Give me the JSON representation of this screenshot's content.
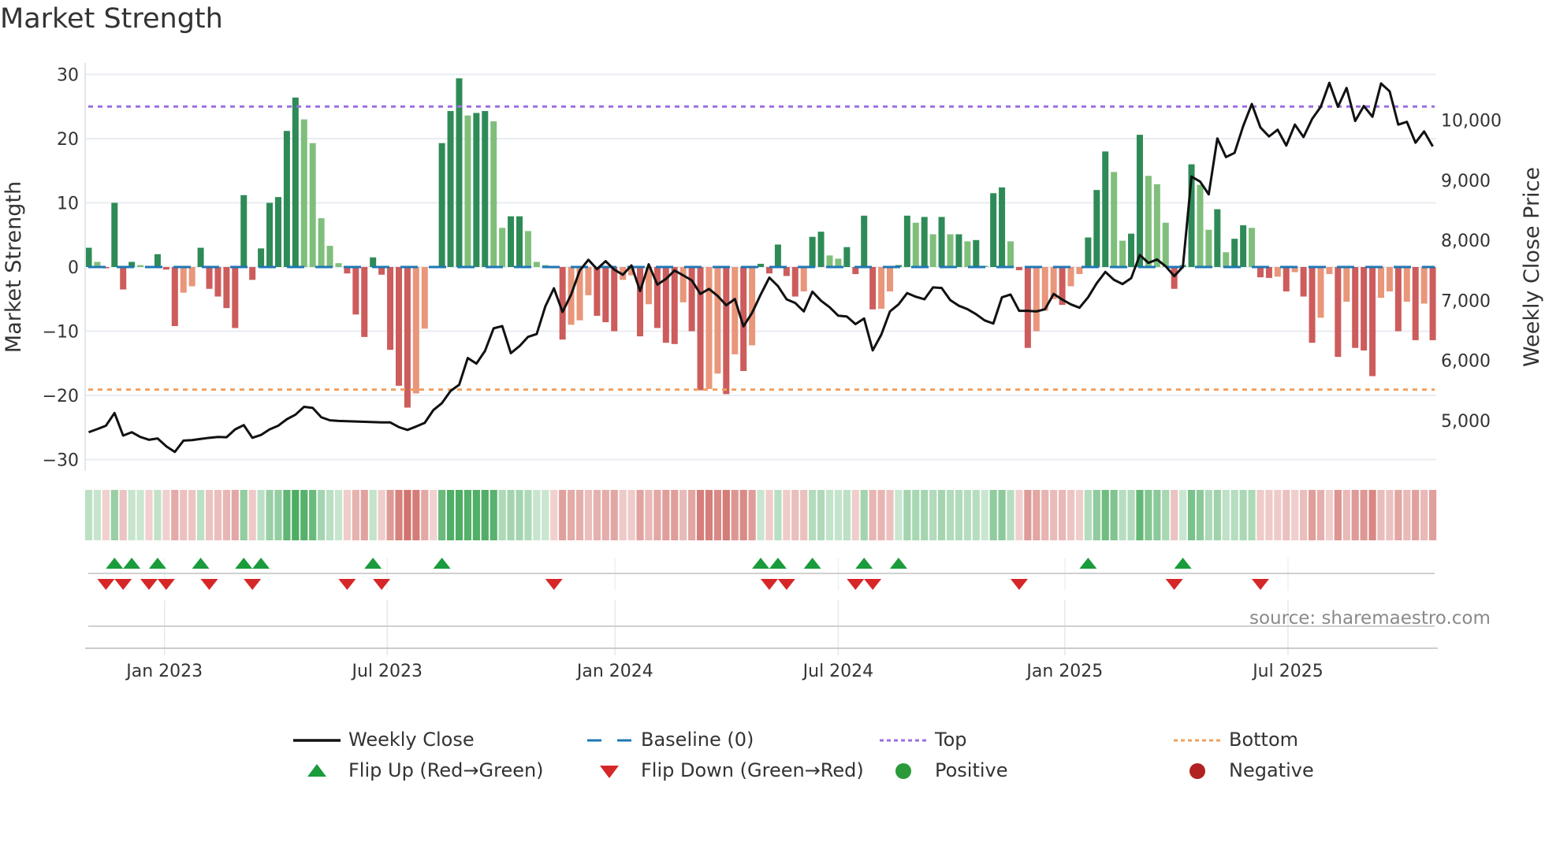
{
  "title": "Market Strength",
  "source": "source: sharemaestro.com",
  "legend": [
    {
      "key": "close",
      "label": "Weekly Close"
    },
    {
      "key": "baseline",
      "label": "Baseline (0)"
    },
    {
      "key": "top",
      "label": "Top"
    },
    {
      "key": "bottom",
      "label": "Bottom"
    },
    {
      "key": "flipup",
      "label": "Flip Up (Red→Green)"
    },
    {
      "key": "flipdown",
      "label": "Flip Down (Green→Red)"
    },
    {
      "key": "positive",
      "label": "Positive"
    },
    {
      "key": "negative",
      "label": "Negative"
    }
  ],
  "colors": {
    "pos_strong": "#2e8b57",
    "pos_weak": "#7fbf7b",
    "neg_strong": "#cd5c5c",
    "neg_weak": "#e9967a",
    "close": "#111111",
    "baseline": "#1f77b4",
    "top": "#9b6fe0",
    "bottom": "#f0a060",
    "flip_up": "#1a9c3c",
    "flip_down": "#d62728",
    "positive": "#2a9a3a",
    "negative": "#b22222"
  },
  "chart_data": {
    "type": "bar",
    "title": "Market Strength",
    "ylabel": "Market Strength",
    "y2label": "Weekly Close Price",
    "ylim": [
      -31.5,
      32
    ],
    "y2lim": [
      4340,
      10750
    ],
    "yticks": [
      -30,
      -20,
      -10,
      0,
      10,
      20,
      30
    ],
    "yticklabels": [
      "−30",
      "−20",
      "−10",
      "0",
      "10",
      "20",
      "30"
    ],
    "y2ticks": [
      5000,
      6000,
      7000,
      8000,
      9000,
      10000
    ],
    "y2ticklabels": [
      "5,000",
      "6,000",
      "7,000",
      "8,000",
      "9,000",
      "10,000"
    ],
    "top_level": 25,
    "bottom_level": -19.1,
    "baseline": 0,
    "x_unit": "week index",
    "xticks": [
      {
        "at": 8.8,
        "label": "Jan 2023"
      },
      {
        "at": 34.65,
        "label": "Jul 2023"
      },
      {
        "at": 61.1,
        "label": "Jan 2024"
      },
      {
        "at": 87.0,
        "label": "Jul 2024"
      },
      {
        "at": 113.3,
        "label": "Jan 2025"
      },
      {
        "at": 139.2,
        "label": "Jul 2025"
      }
    ],
    "strength": [
      3,
      0.8,
      -0.2,
      10,
      -3.5,
      0.8,
      0.3,
      -0.1,
      2,
      -0.4,
      -9.2,
      -4,
      -3,
      3,
      -3.4,
      -4.6,
      -6.4,
      -9.5,
      11.2,
      -2,
      2.9,
      10,
      10.9,
      21.2,
      26.4,
      23,
      19.3,
      7.6,
      3.3,
      0.6,
      -1,
      -7.4,
      -10.9,
      1.5,
      -1.2,
      -12.9,
      -18.5,
      -21.9,
      -19.7,
      -9.6,
      -0.05,
      19.3,
      24.3,
      29.4,
      23.6,
      24,
      24.3,
      22.7,
      6.1,
      7.9,
      7.9,
      5.6,
      0.8,
      0.3,
      -0.2,
      -11.3,
      -9,
      -8.3,
      -4.4,
      -7.6,
      -8.6,
      -10,
      -2,
      -1.3,
      -10.8,
      -5.8,
      -9.5,
      -11.8,
      -12,
      -5.5,
      -10,
      -19.2,
      -19,
      -16.6,
      -19.8,
      -13.6,
      -16.2,
      -12.2,
      0.5,
      -1,
      3.5,
      -1.4,
      -4.6,
      -3.8,
      4.7,
      5.5,
      1.8,
      1.3,
      3.1,
      -1.1,
      8,
      -6.6,
      -6.5,
      -3.8,
      0.3,
      8,
      6.9,
      7.8,
      5.1,
      7.8,
      5.1,
      5.1,
      4,
      4.2,
      0.2,
      11.5,
      12.4,
      4,
      -0.5,
      -12.6,
      -10,
      -6.8,
      -5,
      -5.9,
      -3,
      -1.1,
      4.6,
      12,
      18,
      14.8,
      4.1,
      5.2,
      20.6,
      14.2,
      12.9,
      6.9,
      -3.4,
      0.3,
      16,
      12.8,
      5.8,
      9,
      2.3,
      4.4,
      6.5,
      6.1,
      -1.6,
      -1.7,
      -1.5,
      -3.8,
      -0.8,
      -4.6,
      -11.8,
      -7.9,
      -1.1,
      -14,
      -5.4,
      -12.6,
      -13,
      -17,
      -4.8,
      -3.8,
      -10,
      -5.4,
      -11.4,
      -5.7,
      -11.4
    ],
    "close": [
      4807,
      4859,
      4915,
      5127,
      4751,
      4807,
      4728,
      4681,
      4704,
      4573,
      4479,
      4667,
      4676,
      4695,
      4714,
      4728,
      4723,
      4854,
      4925,
      4714,
      4761,
      4854,
      4915,
      5023,
      5099,
      5230,
      5211,
      5056,
      5005,
      4995,
      4990,
      4985,
      4980,
      4975,
      4970,
      4970,
      4892,
      4845,
      4901,
      4962,
      5174,
      5291,
      5493,
      5596,
      6042,
      5948,
      6160,
      6535,
      6573,
      6122,
      6239,
      6394,
      6441,
      6900,
      7202,
      6807,
      7098,
      7498,
      7676,
      7521,
      7653,
      7512,
      7427,
      7582,
      7155,
      7601,
      7263,
      7357,
      7498,
      7418,
      7333,
      7108,
      7192,
      7075,
      6920,
      7023,
      6568,
      6793,
      7098,
      7380,
      7239,
      7019,
      6958,
      6817,
      7145,
      6995,
      6887,
      6746,
      6732,
      6605,
      6699,
      6169,
      6432,
      6817,
      6934,
      7122,
      7061,
      7019,
      7216,
      7206,
      7005,
      6911,
      6854,
      6770,
      6667,
      6615,
      7052,
      7098,
      6826,
      6826,
      6817,
      6854,
      7108,
      7014,
      6934,
      6878,
      7052,
      7286,
      7474,
      7343,
      7272,
      7371,
      7756,
      7624,
      7681,
      7568,
      7404,
      7559,
      9061,
      8977,
      8765,
      9695,
      9385,
      9455,
      9901,
      10268,
      9878,
      9728,
      9840,
      9577,
      9925,
      9718,
      10019,
      10221,
      10620,
      10221,
      10535,
      9986,
      10235,
      10056,
      10610,
      10479,
      9925,
      9972,
      9624,
      9812,
      9563
    ],
    "flip_up": [
      3,
      5,
      8,
      13,
      18,
      20,
      33,
      41,
      78,
      80,
      84,
      90,
      94,
      116,
      127
    ],
    "flip_down": [
      2,
      4,
      7,
      9,
      14,
      19,
      30,
      34,
      54,
      79,
      81,
      89,
      91,
      108,
      126,
      136
    ]
  }
}
